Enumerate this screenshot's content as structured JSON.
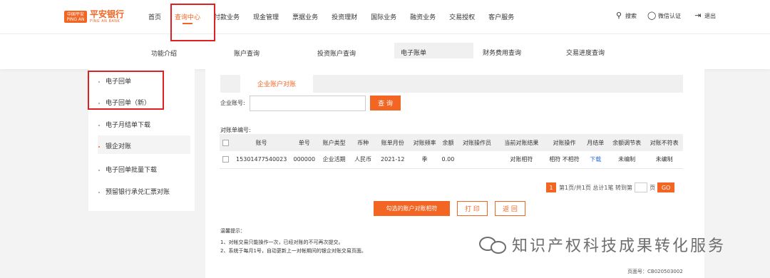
{
  "brand": {
    "logo_badge_top": "中国平安",
    "logo_badge_bottom": "PING AN",
    "name": "平安银行",
    "name_en": "PING AN BANK"
  },
  "nav": {
    "items": [
      "首页",
      "查询中心",
      "付款业务",
      "现金管理",
      "票据业务",
      "投资理财",
      "国际业务",
      "融资业务",
      "交易授权",
      "客户服务"
    ],
    "active_index": 1
  },
  "utilities": {
    "search": "搜索",
    "wechat": "微信认证",
    "logout": "退出"
  },
  "subnav": {
    "items": [
      "功能介绍",
      "账户查询",
      "投资账户查询",
      "电子账单",
      "财务费用查询",
      "交易进度查询"
    ],
    "active": "电子账单"
  },
  "sidebar": {
    "items": [
      "电子回单",
      "电子回单（新）",
      "电子月结单下载",
      "银企对账",
      "电子回单批量下载",
      "预留银行承兑汇票对账"
    ],
    "active": "银企对账"
  },
  "tabs": {
    "active_label": "企业账户对账"
  },
  "form": {
    "account_label": "企业账号:",
    "account_value": "",
    "query_button": "查 询"
  },
  "statement": {
    "title": "对账单编号:",
    "columns": [
      "账号",
      "单号",
      "账户类型",
      "币种",
      "账单月份",
      "对账频率",
      "余额",
      "对账操作员",
      "当前对账结果",
      "对账操作",
      "月结单",
      "余额调节表",
      "对账不符表"
    ],
    "rows": [
      {
        "account": "15301477540023",
        "number": "000000",
        "type": "企业活期",
        "currency": "人民币",
        "month": "2021-12",
        "frequency": "季",
        "balance": "0.00",
        "operator": "",
        "result": "对账相符",
        "action": "相符 不相符",
        "monthly": "下载",
        "adjust": "未编制",
        "mismatch": "未编制"
      }
    ]
  },
  "pager": {
    "current": "1",
    "text": "第1页/共1页 总计1笔 转到第",
    "page_suffix": "页",
    "go": "GO"
  },
  "actions": {
    "confirm": "勾选的账户对账相符",
    "print": "打 印",
    "back": "返 回"
  },
  "tips": {
    "title": "温馨提示：",
    "lines": [
      "1、对帐交易只能操作一次，已经对账的不可再次提交。",
      "2、系统于每月1号，自动更新上一对帐期间的银企对账交易页面。"
    ]
  },
  "page_number": "页面号：CB020503002",
  "watermark": "知识产权科技成果转化服务",
  "colors": {
    "accent": "#f26522",
    "highlight_box": "#e02020",
    "link": "#2a6fd6"
  }
}
